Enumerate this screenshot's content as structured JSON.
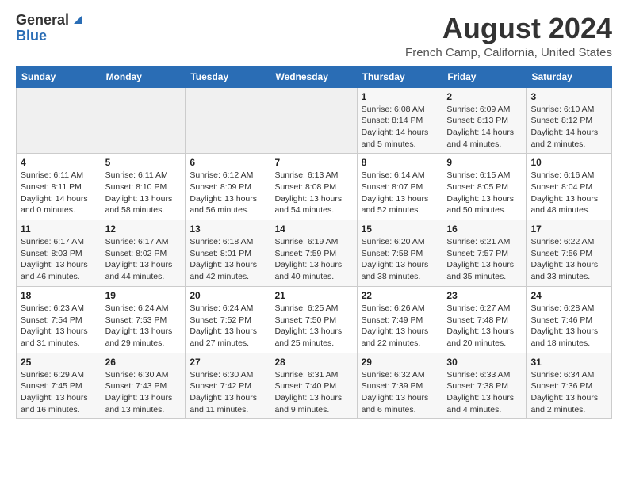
{
  "logo": {
    "general": "General",
    "blue": "Blue"
  },
  "title": "August 2024",
  "location": "French Camp, California, United States",
  "days_of_week": [
    "Sunday",
    "Monday",
    "Tuesday",
    "Wednesday",
    "Thursday",
    "Friday",
    "Saturday"
  ],
  "weeks": [
    [
      {
        "day": "",
        "info": ""
      },
      {
        "day": "",
        "info": ""
      },
      {
        "day": "",
        "info": ""
      },
      {
        "day": "",
        "info": ""
      },
      {
        "day": "1",
        "info": "Sunrise: 6:08 AM\nSunset: 8:14 PM\nDaylight: 14 hours\nand 5 minutes."
      },
      {
        "day": "2",
        "info": "Sunrise: 6:09 AM\nSunset: 8:13 PM\nDaylight: 14 hours\nand 4 minutes."
      },
      {
        "day": "3",
        "info": "Sunrise: 6:10 AM\nSunset: 8:12 PM\nDaylight: 14 hours\nand 2 minutes."
      }
    ],
    [
      {
        "day": "4",
        "info": "Sunrise: 6:11 AM\nSunset: 8:11 PM\nDaylight: 14 hours\nand 0 minutes."
      },
      {
        "day": "5",
        "info": "Sunrise: 6:11 AM\nSunset: 8:10 PM\nDaylight: 13 hours\nand 58 minutes."
      },
      {
        "day": "6",
        "info": "Sunrise: 6:12 AM\nSunset: 8:09 PM\nDaylight: 13 hours\nand 56 minutes."
      },
      {
        "day": "7",
        "info": "Sunrise: 6:13 AM\nSunset: 8:08 PM\nDaylight: 13 hours\nand 54 minutes."
      },
      {
        "day": "8",
        "info": "Sunrise: 6:14 AM\nSunset: 8:07 PM\nDaylight: 13 hours\nand 52 minutes."
      },
      {
        "day": "9",
        "info": "Sunrise: 6:15 AM\nSunset: 8:05 PM\nDaylight: 13 hours\nand 50 minutes."
      },
      {
        "day": "10",
        "info": "Sunrise: 6:16 AM\nSunset: 8:04 PM\nDaylight: 13 hours\nand 48 minutes."
      }
    ],
    [
      {
        "day": "11",
        "info": "Sunrise: 6:17 AM\nSunset: 8:03 PM\nDaylight: 13 hours\nand 46 minutes."
      },
      {
        "day": "12",
        "info": "Sunrise: 6:17 AM\nSunset: 8:02 PM\nDaylight: 13 hours\nand 44 minutes."
      },
      {
        "day": "13",
        "info": "Sunrise: 6:18 AM\nSunset: 8:01 PM\nDaylight: 13 hours\nand 42 minutes."
      },
      {
        "day": "14",
        "info": "Sunrise: 6:19 AM\nSunset: 7:59 PM\nDaylight: 13 hours\nand 40 minutes."
      },
      {
        "day": "15",
        "info": "Sunrise: 6:20 AM\nSunset: 7:58 PM\nDaylight: 13 hours\nand 38 minutes."
      },
      {
        "day": "16",
        "info": "Sunrise: 6:21 AM\nSunset: 7:57 PM\nDaylight: 13 hours\nand 35 minutes."
      },
      {
        "day": "17",
        "info": "Sunrise: 6:22 AM\nSunset: 7:56 PM\nDaylight: 13 hours\nand 33 minutes."
      }
    ],
    [
      {
        "day": "18",
        "info": "Sunrise: 6:23 AM\nSunset: 7:54 PM\nDaylight: 13 hours\nand 31 minutes."
      },
      {
        "day": "19",
        "info": "Sunrise: 6:24 AM\nSunset: 7:53 PM\nDaylight: 13 hours\nand 29 minutes."
      },
      {
        "day": "20",
        "info": "Sunrise: 6:24 AM\nSunset: 7:52 PM\nDaylight: 13 hours\nand 27 minutes."
      },
      {
        "day": "21",
        "info": "Sunrise: 6:25 AM\nSunset: 7:50 PM\nDaylight: 13 hours\nand 25 minutes."
      },
      {
        "day": "22",
        "info": "Sunrise: 6:26 AM\nSunset: 7:49 PM\nDaylight: 13 hours\nand 22 minutes."
      },
      {
        "day": "23",
        "info": "Sunrise: 6:27 AM\nSunset: 7:48 PM\nDaylight: 13 hours\nand 20 minutes."
      },
      {
        "day": "24",
        "info": "Sunrise: 6:28 AM\nSunset: 7:46 PM\nDaylight: 13 hours\nand 18 minutes."
      }
    ],
    [
      {
        "day": "25",
        "info": "Sunrise: 6:29 AM\nSunset: 7:45 PM\nDaylight: 13 hours\nand 16 minutes."
      },
      {
        "day": "26",
        "info": "Sunrise: 6:30 AM\nSunset: 7:43 PM\nDaylight: 13 hours\nand 13 minutes."
      },
      {
        "day": "27",
        "info": "Sunrise: 6:30 AM\nSunset: 7:42 PM\nDaylight: 13 hours\nand 11 minutes."
      },
      {
        "day": "28",
        "info": "Sunrise: 6:31 AM\nSunset: 7:40 PM\nDaylight: 13 hours\nand 9 minutes."
      },
      {
        "day": "29",
        "info": "Sunrise: 6:32 AM\nSunset: 7:39 PM\nDaylight: 13 hours\nand 6 minutes."
      },
      {
        "day": "30",
        "info": "Sunrise: 6:33 AM\nSunset: 7:38 PM\nDaylight: 13 hours\nand 4 minutes."
      },
      {
        "day": "31",
        "info": "Sunrise: 6:34 AM\nSunset: 7:36 PM\nDaylight: 13 hours\nand 2 minutes."
      }
    ]
  ]
}
